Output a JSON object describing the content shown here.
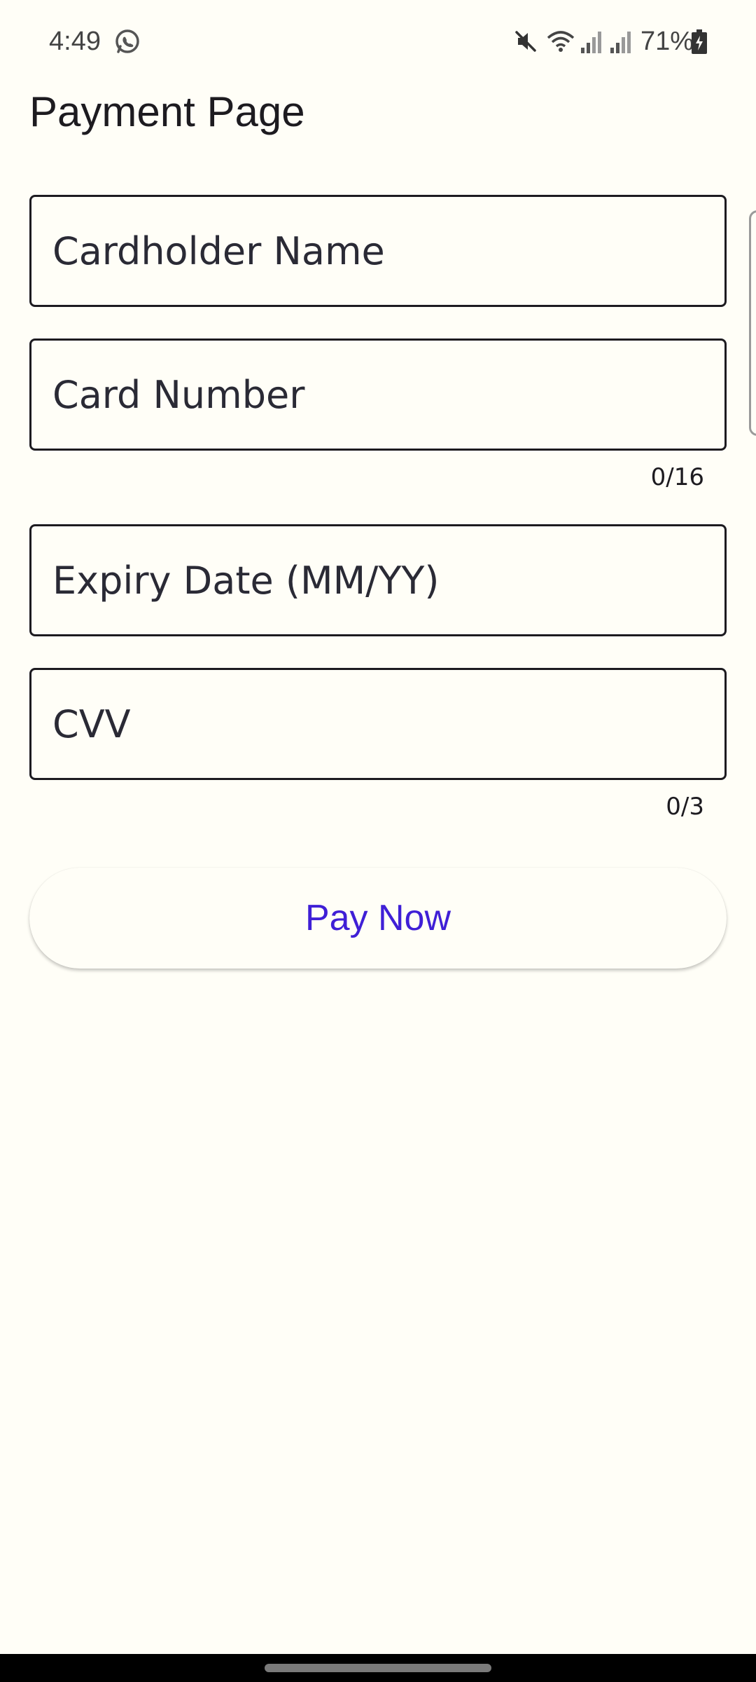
{
  "status_bar": {
    "time": "4:49",
    "battery": "71%",
    "icons": [
      "whatsapp-icon",
      "mute-icon",
      "wifi-icon",
      "signal-icon",
      "signal-icon",
      "battery-icon"
    ]
  },
  "page": {
    "title": "Payment Page"
  },
  "form": {
    "cardholder_name": {
      "placeholder": "Cardholder Name",
      "value": ""
    },
    "card_number": {
      "placeholder": "Card Number",
      "value": "",
      "counter": "0/16"
    },
    "expiry_date": {
      "placeholder": "Expiry Date (MM/YY)",
      "value": ""
    },
    "cvv": {
      "placeholder": "CVV",
      "value": "",
      "counter": "0/3"
    }
  },
  "actions": {
    "pay_label": "Pay Now"
  },
  "colors": {
    "background": "#fffef7",
    "accent": "#3f1fd6",
    "text": "#1d1b20"
  }
}
